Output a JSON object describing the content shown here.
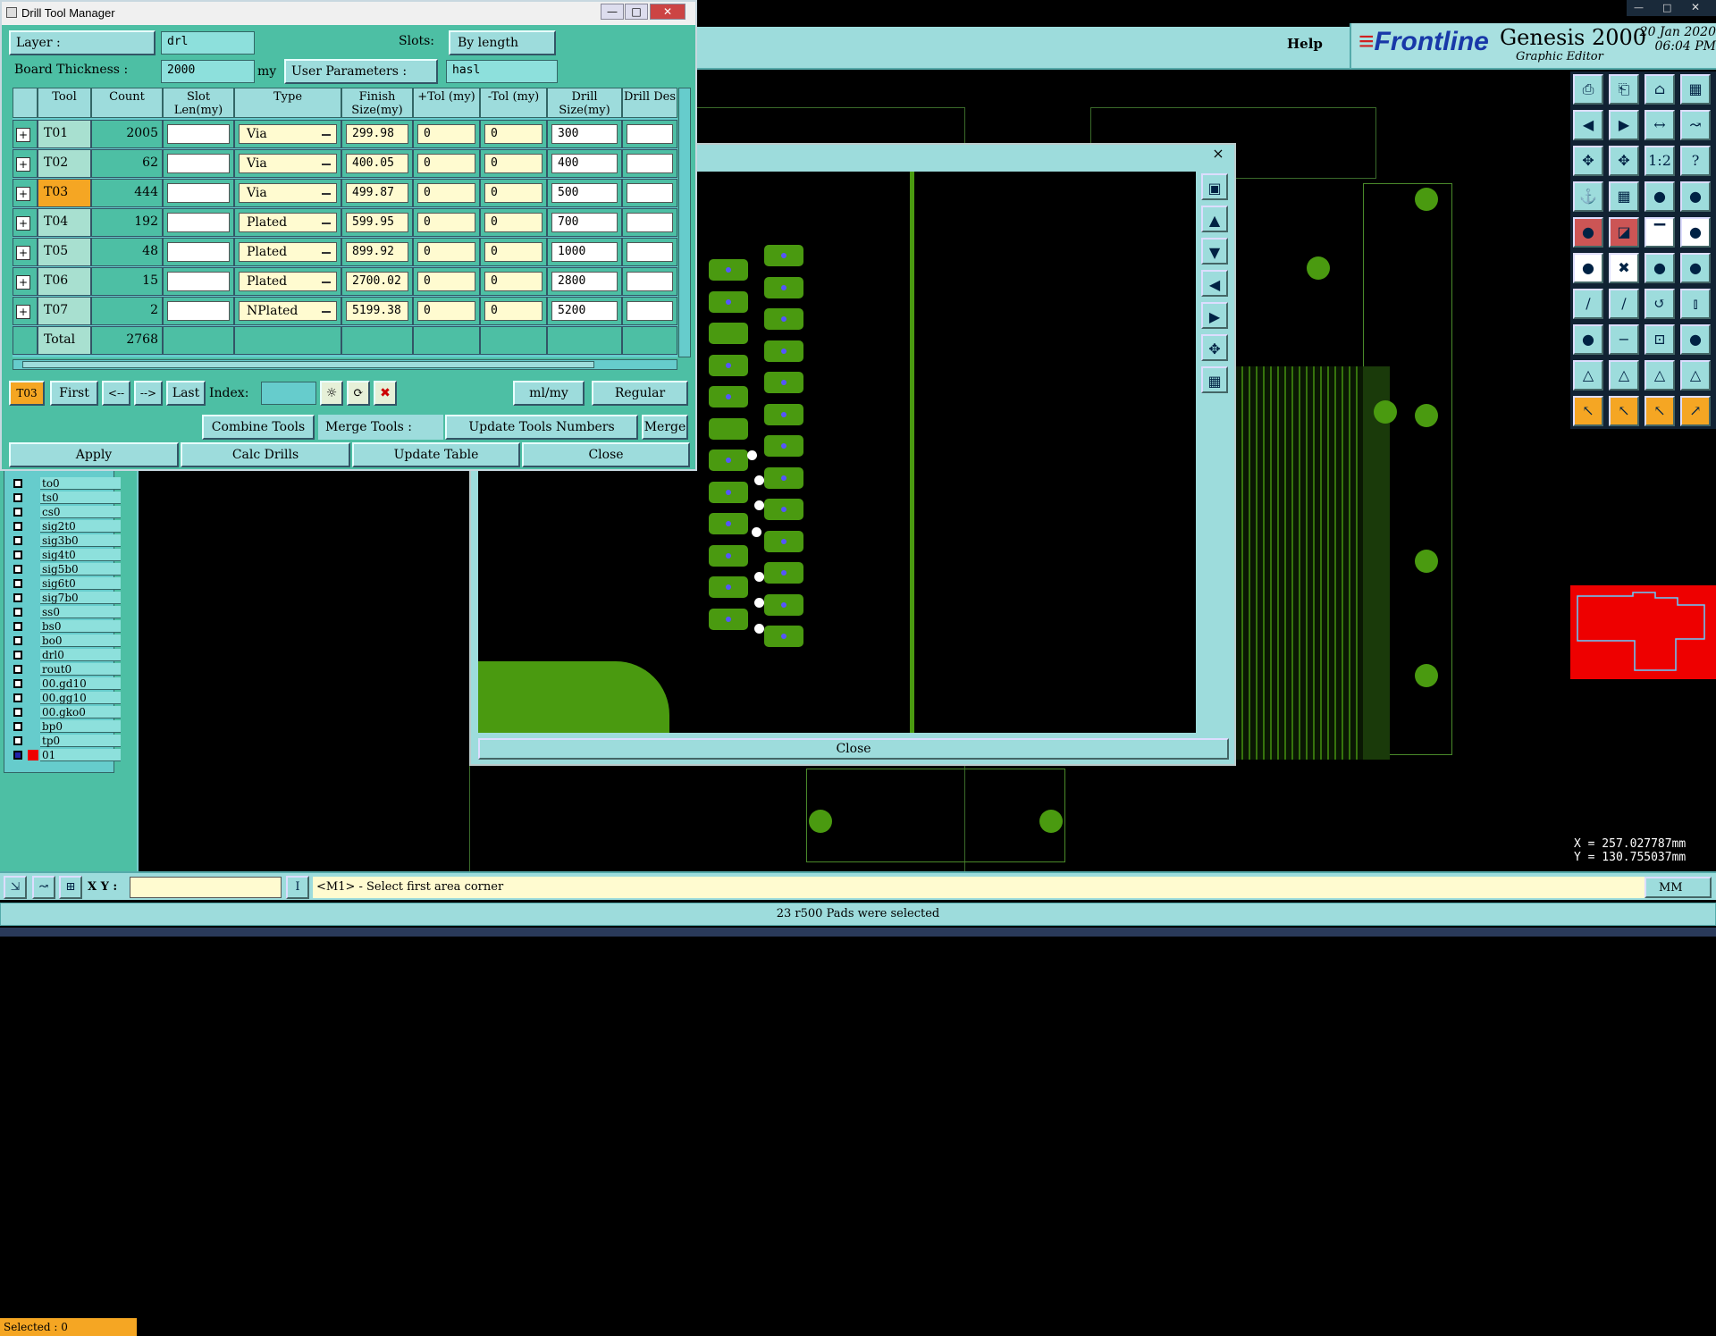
{
  "header": {
    "help": "Help",
    "logo_prefix": "≡",
    "logo": "Frontline",
    "product": "Genesis 2000",
    "product_sub": "Graphic Editor",
    "date": "20 Jan 2020",
    "time": "06:04 PM"
  },
  "dialog": {
    "title": "Drill Tool Manager",
    "layer_label": "Layer :",
    "layer_value": "drl",
    "slots_label": "Slots:",
    "slots_value": "By length",
    "thickness_label": "Board Thickness :",
    "thickness_value": "2000",
    "thickness_unit": "my",
    "user_params_label": "User Parameters :",
    "user_params_value": "hasl",
    "columns": [
      "Tool",
      "Count",
      "Slot Len(my)",
      "Type",
      "Finish Size(my)",
      "+Tol (my)",
      "-Tol (my)",
      "Drill Size(my)",
      "Drill Des"
    ],
    "rows": [
      {
        "tool": "T01",
        "count": "2005",
        "type": "Via",
        "finish": "299.98",
        "ptol": "0",
        "ntol": "0",
        "drill": "300"
      },
      {
        "tool": "T02",
        "count": "62",
        "type": "Via",
        "finish": "400.05",
        "ptol": "0",
        "ntol": "0",
        "drill": "400"
      },
      {
        "tool": "T03",
        "count": "444",
        "type": "Via",
        "finish": "499.87",
        "ptol": "0",
        "ntol": "0",
        "drill": "500"
      },
      {
        "tool": "T04",
        "count": "192",
        "type": "Plated",
        "finish": "599.95",
        "ptol": "0",
        "ntol": "0",
        "drill": "700"
      },
      {
        "tool": "T05",
        "count": "48",
        "type": "Plated",
        "finish": "899.92",
        "ptol": "0",
        "ntol": "0",
        "drill": "1000"
      },
      {
        "tool": "T06",
        "count": "15",
        "type": "Plated",
        "finish": "2700.02",
        "ptol": "0",
        "ntol": "0",
        "drill": "2800"
      },
      {
        "tool": "T07",
        "count": "2",
        "type": "NPlated",
        "finish": "5199.38",
        "ptol": "0",
        "ntol": "0",
        "drill": "5200"
      }
    ],
    "total_label": "Total",
    "total_count": "2768",
    "current_tool": "T03",
    "nav": {
      "first": "First",
      "prev": "<--",
      "next": "-->",
      "last": "Last",
      "index": "Index:"
    },
    "units": "ml/my",
    "mode": "Regular",
    "combine": "Combine Tools",
    "merge_tools": "Merge Tools :",
    "update_numbers": "Update Tools Numbers",
    "merge": "Merge",
    "apply": "Apply",
    "calc": "Calc Drills",
    "update_table": "Update Table",
    "close": "Close"
  },
  "layers": [
    "to0",
    "ts0",
    "cs0",
    "sig2t0",
    "sig3b0",
    "sig4t0",
    "sig5b0",
    "sig6t0",
    "sig7b0",
    "ss0",
    "bs0",
    "bo0",
    "drl0",
    "rout0",
    "00.gd10",
    "00.gg10",
    "00.gko0",
    "bp0",
    "tp0",
    "01"
  ],
  "selected": "Selected : 0",
  "zoom": {
    "close": "Close",
    "x": "×"
  },
  "coords": {
    "x": "X = 257.027787mm",
    "y": "Y = 130.755037mm"
  },
  "status": {
    "xy_label": "X Y :",
    "prompt": "<M1> - Select first area corner",
    "units": "MM",
    "message": "23 r500 Pads were selected"
  },
  "colors": {
    "panel": "#4dbfa4",
    "header": "#9ddcdc",
    "highlight": "#f5a623",
    "trace": "#4a9a10",
    "input": "#fffbd0"
  }
}
